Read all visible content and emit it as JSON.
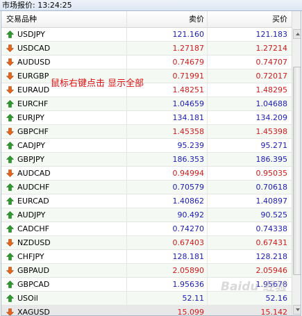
{
  "window": {
    "title": "市场报价: 13:24:25"
  },
  "columns": {
    "symbol": "交易品种",
    "bid": "卖价",
    "ask": "买价"
  },
  "colors": {
    "up": "#1b1bb5",
    "down": "#d11a1a",
    "up_icon": "#2e9b2e",
    "down_icon": "#e8641c"
  },
  "rows": [
    {
      "symbol": "USDJPY",
      "bid": "121.160",
      "ask": "121.183",
      "direction": "up"
    },
    {
      "symbol": "USDCAD",
      "bid": "1.27187",
      "ask": "1.27214",
      "direction": "down"
    },
    {
      "symbol": "AUDUSD",
      "bid": "0.74679",
      "ask": "0.74707",
      "direction": "down"
    },
    {
      "symbol": "EURGBP",
      "bid": "0.71991",
      "ask": "0.72017",
      "direction": "down"
    },
    {
      "symbol": "EURAUD",
      "bid": "1.48251",
      "ask": "1.48295",
      "direction": "down"
    },
    {
      "symbol": "EURCHF",
      "bid": "1.04659",
      "ask": "1.04688",
      "direction": "up"
    },
    {
      "symbol": "EURJPY",
      "bid": "134.181",
      "ask": "134.209",
      "direction": "up"
    },
    {
      "symbol": "GBPCHF",
      "bid": "1.45358",
      "ask": "1.45398",
      "direction": "down"
    },
    {
      "symbol": "CADJPY",
      "bid": "95.239",
      "ask": "95.271",
      "direction": "up"
    },
    {
      "symbol": "GBPJPY",
      "bid": "186.353",
      "ask": "186.395",
      "direction": "up"
    },
    {
      "symbol": "AUDCAD",
      "bid": "0.94994",
      "ask": "0.95035",
      "direction": "down"
    },
    {
      "symbol": "AUDCHF",
      "bid": "0.70579",
      "ask": "0.70618",
      "direction": "up"
    },
    {
      "symbol": "EURCAD",
      "bid": "1.40862",
      "ask": "1.40897",
      "direction": "up"
    },
    {
      "symbol": "AUDJPY",
      "bid": "90.492",
      "ask": "90.525",
      "direction": "up"
    },
    {
      "symbol": "CADCHF",
      "bid": "0.74270",
      "ask": "0.74338",
      "direction": "up"
    },
    {
      "symbol": "NZDUSD",
      "bid": "0.67403",
      "ask": "0.67431",
      "direction": "down"
    },
    {
      "symbol": "CHFJPY",
      "bid": "128.181",
      "ask": "128.218",
      "direction": "up"
    },
    {
      "symbol": "GBPAUD",
      "bid": "2.05890",
      "ask": "2.05946",
      "direction": "down"
    },
    {
      "symbol": "GBPCAD",
      "bid": "1.95636",
      "ask": "1.95678",
      "direction": "up"
    },
    {
      "symbol": "USOil",
      "bid": "52.11",
      "ask": "52.16",
      "direction": "up"
    },
    {
      "symbol": "XAGUSD",
      "bid": "15.099",
      "ask": "15.142",
      "direction": "down",
      "selected": true
    }
  ],
  "annotation": {
    "text": "鼠标右键点击 显示全部"
  },
  "watermark": {
    "text": "Baidu 经验"
  }
}
